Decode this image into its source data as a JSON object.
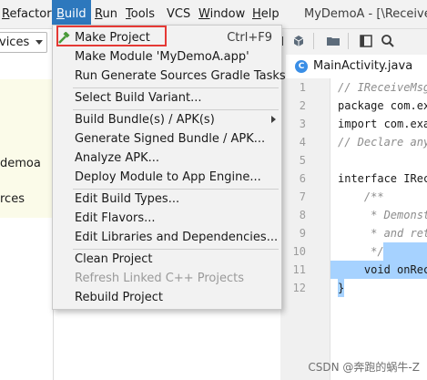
{
  "menubar": {
    "items": [
      {
        "label": "Refactor",
        "mnemonic": "R",
        "rest": "efactor"
      },
      {
        "label": "Build",
        "mnemonic": "B",
        "rest": "uild"
      },
      {
        "label": "Run",
        "mnemonic": "R",
        "rest": "un"
      },
      {
        "label": "Tools",
        "mnemonic": "T",
        "rest": "ools"
      },
      {
        "label": "VCS",
        "mnemonic": "",
        "rest": "VCS"
      },
      {
        "label": "Window",
        "mnemonic": "W",
        "rest": "indow"
      },
      {
        "label": "Help",
        "mnemonic": "H",
        "rest": "elp"
      }
    ],
    "window_title": "MyDemoA - [\\ReceiveM"
  },
  "left_panel": {
    "config_value": "vices",
    "text_1": "demoa",
    "text_2": "rces"
  },
  "build_menu": {
    "items": [
      {
        "label": "Make Project",
        "shortcut": "Ctrl+F9",
        "icon": "hammer-icon"
      },
      {
        "label": "Make Module 'MyDemoA.app'"
      },
      {
        "label": "Run Generate Sources Gradle Tasks"
      },
      {
        "label": "Select Build Variant..."
      },
      {
        "label": "Build Bundle(s) / APK(s)",
        "submenu": true
      },
      {
        "label": "Generate Signed Bundle / APK..."
      },
      {
        "label": "Analyze APK..."
      },
      {
        "label": "Deploy Module to App Engine..."
      },
      {
        "label": "Edit Build Types..."
      },
      {
        "label": "Edit Flavors..."
      },
      {
        "label": "Edit Libraries and Dependencies..."
      },
      {
        "label": "Clean Project"
      },
      {
        "label": "Refresh Linked C++ Projects",
        "disabled": true
      },
      {
        "label": "Rebuild Project"
      }
    ]
  },
  "editor": {
    "tab_label": "MainActivity.java",
    "tab_icon": "C",
    "line_numbers": [
      "1",
      "2",
      "3",
      "4",
      "5",
      "6",
      "7",
      "8",
      "9",
      "10",
      "11",
      "12"
    ],
    "lines": [
      "// IReceiveMsg",
      "package com.ex",
      "import com.exa",
      "// Declare any",
      "",
      "interface IRec",
      "    /**",
      "     * Demonst",
      "     * and ret",
      "     */",
      "    void onRec",
      "}"
    ]
  },
  "watermark": "CSDN @奔跑的蜗牛-Z"
}
